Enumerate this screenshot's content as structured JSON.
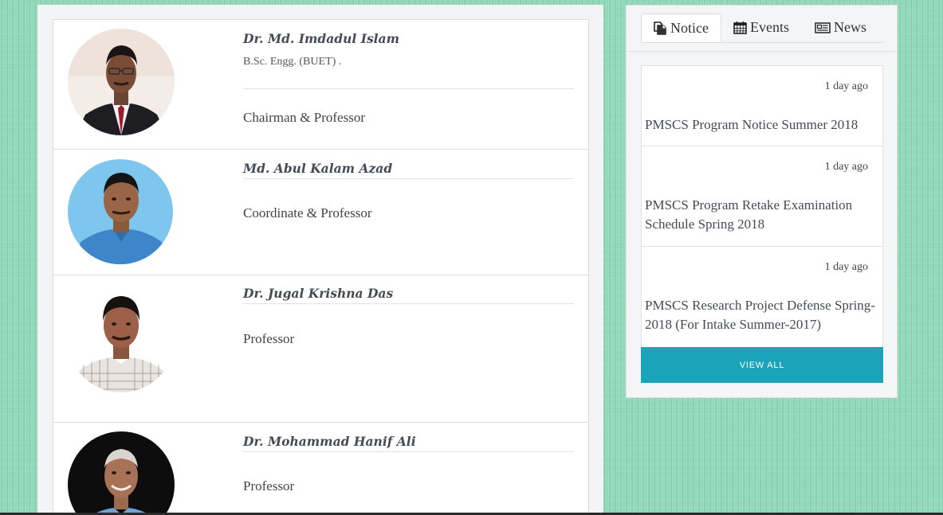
{
  "faculty": [
    {
      "name": "Dr. Md. Imdadul Islam",
      "degree": "B.Sc. Engg. (BUET) .",
      "designation": "Chairman & Professor"
    },
    {
      "name": "Md. Abul Kalam Azad",
      "designation": "Coordinate & Professor"
    },
    {
      "name": "Dr. Jugal Krishna Das",
      "designation": "Professor"
    },
    {
      "name": "Dr. Mohammad Hanif Ali",
      "designation": "Professor"
    }
  ],
  "side_panel": {
    "tabs": [
      {
        "label": "Notice",
        "icon": "file-copy-icon",
        "active": true
      },
      {
        "label": "Events",
        "icon": "calendar-icon",
        "active": false
      },
      {
        "label": "News",
        "icon": "newspaper-icon",
        "active": false
      }
    ],
    "notices": [
      {
        "time": "1 day ago",
        "title": "PMSCS Program Notice Summer 2018"
      },
      {
        "time": "1 day ago",
        "title": "PMSCS Program Retake Examination Schedule Spring 2018"
      },
      {
        "time": "1 day ago",
        "title": "PMSCS Research Project Defense Spring-2018 (For Intake Summer-2017)"
      }
    ],
    "view_all_label": "VIEW ALL"
  },
  "colors": {
    "page_background": "#8fd8b9",
    "view_all_button": "#1ba3b9",
    "name_text": "#444b55"
  }
}
